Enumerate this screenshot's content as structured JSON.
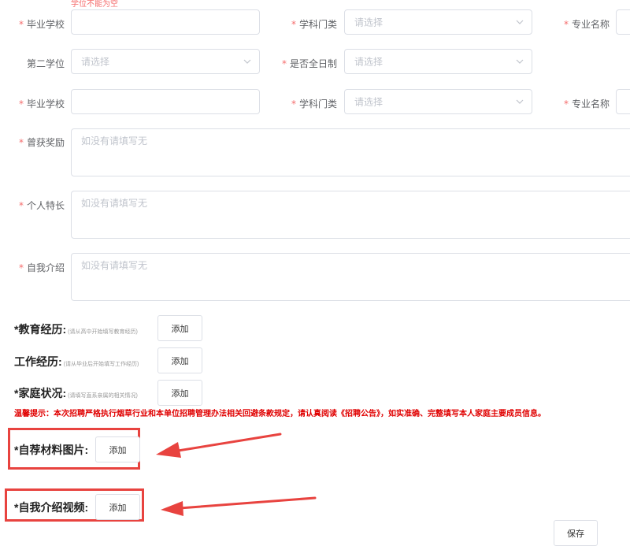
{
  "top_error": "学位不能为空",
  "row1": {
    "school_label": "毕业学校",
    "category_label": "学科门类",
    "category_placeholder": "请选择",
    "major_label": "专业名称"
  },
  "row2": {
    "second_degree_label": "第二学位",
    "second_degree_placeholder": "请选择",
    "fulltime_label": "是否全日制",
    "fulltime_placeholder": "请选择"
  },
  "row3": {
    "school_label": "毕业学校",
    "category_label": "学科门类",
    "category_placeholder": "请选择",
    "major_label": "专业名称"
  },
  "awards": {
    "label": "曾获奖励",
    "placeholder": "如没有请填写无"
  },
  "specialty": {
    "label": "个人特长",
    "placeholder": "如没有请填写无"
  },
  "intro": {
    "label": "自我介绍",
    "placeholder": "如没有请填写无"
  },
  "sections": {
    "education": {
      "title": "*教育经历:",
      "hint": "(请从高中开始填写教育经历)",
      "button": "添加"
    },
    "work": {
      "title": "工作经历:",
      "hint": "(请从毕业后开始填写工作经历)",
      "button": "添加"
    },
    "family": {
      "title": "*家庭状况:",
      "hint": "(请填写直系亲属的相关情况)",
      "button": "添加"
    },
    "materials": {
      "title": "*自荐材料图片:",
      "button": "添加"
    },
    "video": {
      "title": "*自我介绍视频:",
      "button": "添加"
    }
  },
  "warm_tip": "温馨提示：本次招聘严格执行烟草行业和本单位招聘管理办法相关回避条款规定，请认真阅读《招聘公告》，如实准确、完整填写本人家庭主要成员信息。",
  "save_button": "保存",
  "colors": {
    "required_star": "#f56c6c",
    "warning_text": "#e00000",
    "highlight_box": "#e8433f",
    "border": "#dcdfe6",
    "placeholder": "#c0c4cc"
  }
}
